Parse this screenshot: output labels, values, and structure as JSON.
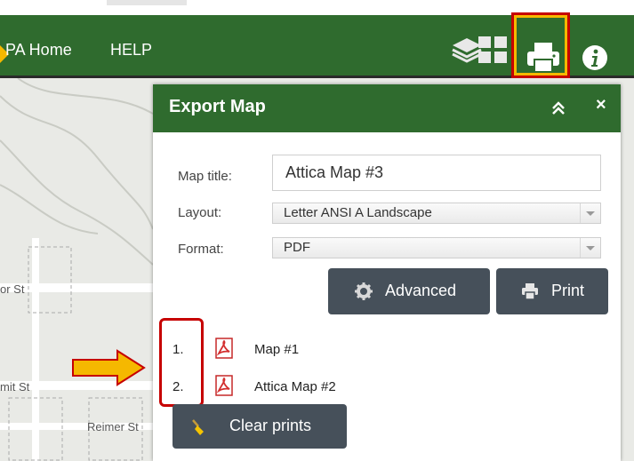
{
  "navbar": {
    "home_label": "PA Home",
    "help_label": "HELP",
    "icons": [
      "layers-icon",
      "grid-icon",
      "print-icon",
      "info-icon"
    ]
  },
  "map": {
    "streets": [
      "or St",
      "mit St",
      "Reimer St"
    ]
  },
  "panel": {
    "title": "Export Map",
    "collapse_icon": "double-chevron-up-icon",
    "close_label": "×",
    "fields": {
      "map_title_label": "Map title:",
      "map_title_value": "Attica Map #3",
      "layout_label": "Layout:",
      "layout_value": "Letter ANSI A Landscape",
      "format_label": "Format:",
      "format_value": "PDF"
    },
    "buttons": {
      "advanced": "Advanced",
      "print": "Print",
      "clear": "Clear prints"
    },
    "prints": [
      {
        "num": "1.",
        "label": "Map #1"
      },
      {
        "num": "2.",
        "label": "Attica Map #2"
      }
    ]
  },
  "colors": {
    "green": "#2f6b2e",
    "button": "#46505a",
    "highlight_red": "#c60000",
    "highlight_yellow": "#f5b800"
  }
}
